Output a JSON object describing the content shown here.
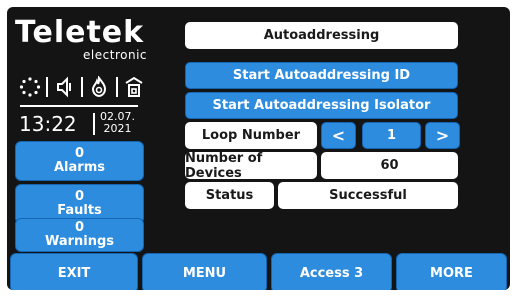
{
  "brand": {
    "name": "Teletek",
    "subtitle": "electronic"
  },
  "status_icons": [
    "network-status-icon",
    "speaker-muted-icon",
    "fire-alarm-icon",
    "building-icon"
  ],
  "clock": {
    "time": "13:22",
    "date_day_month": "02.07.",
    "date_year": "2021"
  },
  "counters": [
    {
      "value": "0",
      "label": "Alarms"
    },
    {
      "value": "0",
      "label": "Faults"
    },
    {
      "value": "0",
      "label": "Warnings"
    }
  ],
  "panel": {
    "title": "Autoaddressing",
    "start_id_label": "Start Autoaddressing ID",
    "start_isolator_label": "Start Autoaddressing Isolator",
    "loop_number_label": "Loop Number",
    "loop_prev": "<",
    "loop_value": "1",
    "loop_next": ">",
    "devices_label": "Number of Devices",
    "devices_value": "60",
    "status_label": "Status",
    "status_value": "Successful"
  },
  "bottom_bar": {
    "exit_label": "EXIT",
    "menu_label": "MENU",
    "access_label": "Access 3",
    "more_label": "MORE"
  },
  "colors": {
    "background": "#141414",
    "button_blue": "#2e8cde",
    "button_border": "#1566b3",
    "text_white": "#ffffff"
  }
}
